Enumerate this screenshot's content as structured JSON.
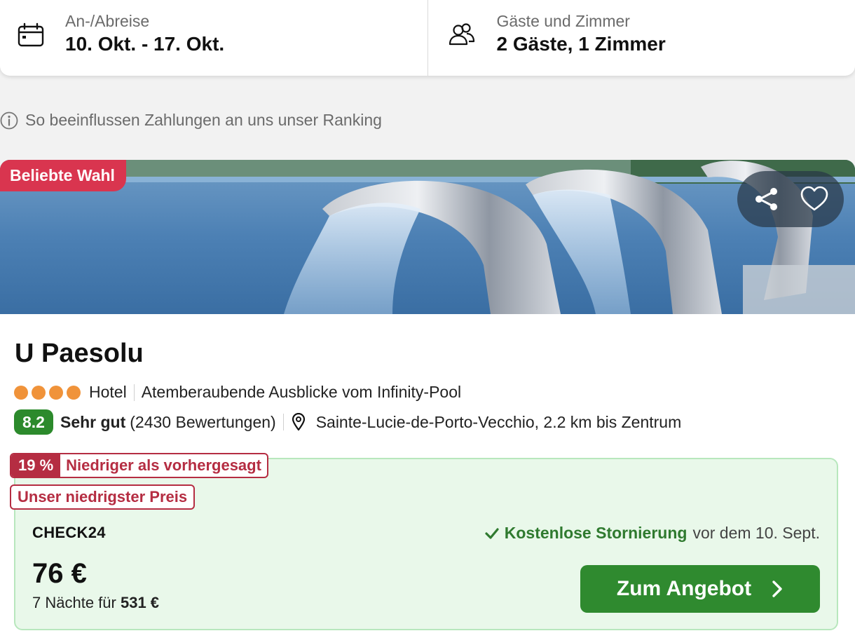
{
  "search": {
    "dates": {
      "label": "An-/Abreise",
      "value": "10. Okt. - 17. Okt.",
      "icon": "calendar-icon"
    },
    "guests": {
      "label": "Gäste und Zimmer",
      "value": "2 Gäste, 1 Zimmer",
      "icon": "users-icon"
    }
  },
  "ranking_note": {
    "text": "So beeinflussen Zahlungen an uns unser Ranking",
    "icon": "info-icon"
  },
  "hotel": {
    "badge": "Beliebte Wahl",
    "actions": {
      "share_icon": "share-icon",
      "favorite_icon": "heart-icon"
    },
    "name": "U Paesolu",
    "stars": 4,
    "type": "Hotel",
    "highlight": "Atemberaubende Ausblicke vom Infinity-Pool",
    "score": "8.2",
    "rating_word": "Sehr gut",
    "reviews": "(2430 Bewertungen)",
    "location": "Sainte-Lucie-de-Porto-Vecchio, 2.2 km bis Zentrum"
  },
  "offer": {
    "discount_pct": "19 %",
    "discount_text": "Niedriger als vorhergesagt",
    "lowest_price_tag": "Unser niedrigster Preis",
    "provider": "CHECK24",
    "cancellation_strong": "Kostenlose Stornierung",
    "cancellation_rest": "vor dem 10. Sept.",
    "price": "76 €",
    "nights_text": "7 Nächte für",
    "total": "531 €",
    "cta_label": "Zum Angebot"
  },
  "colors": {
    "badge_red": "#d9354f",
    "tag_red": "#b52d42",
    "score_green": "#2c8a2c",
    "cta_green": "#2f8a2f",
    "offer_bg": "#e9f8ea",
    "star_orange": "#f0933a"
  }
}
